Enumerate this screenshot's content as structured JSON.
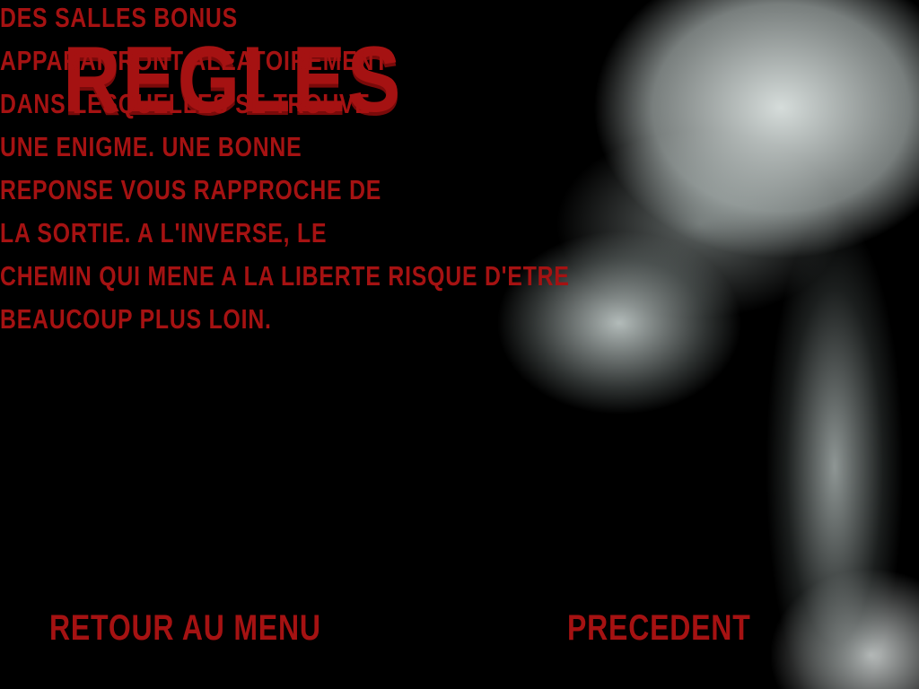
{
  "title": "REGLES",
  "rules_lines": [
    "DES SALLES BONUS",
    "APPARAITRONT ALEATOIREMENT",
    "DANS LESQUELLES SE TROUVE",
    "UNE ENIGME. UNE BONNE",
    "REPONSE VOUS RAPPROCHE DE",
    "LA SORTIE. A L'INVERSE, LE",
    "CHEMIN QUI MENE A LA LIBERTE RISQUE D'ETRE",
    "BEAUCOUP PLUS LOIN."
  ],
  "buttons": {
    "back_to_menu": "RETOUR AU MENU",
    "previous": "PRECEDENT"
  },
  "colors": {
    "text": "#a51212",
    "background": "#000000"
  },
  "background_image": "skull-xray-profile"
}
